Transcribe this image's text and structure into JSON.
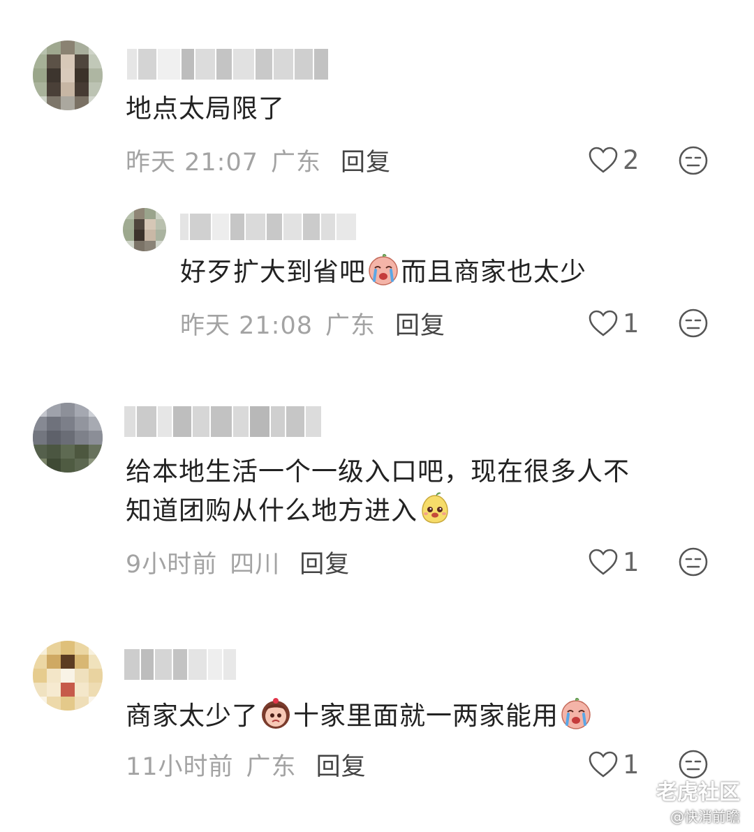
{
  "comments": [
    {
      "text": "地点太局限了",
      "time": "昨天 21:07",
      "location": "广东",
      "reply_label": "回复",
      "likes": "2"
    },
    {
      "text_before_emoji": "好歹扩大到省吧",
      "emoji": "crying-emoji",
      "text_after_emoji": "而且商家也太少",
      "time": "昨天 21:08",
      "location": "广东",
      "reply_label": "回复",
      "likes": "1"
    },
    {
      "text_line1": "给本地生活一个一级入口吧，现在很多人不",
      "text_line2": "知道团购从什么地方进入",
      "emoji": "smiling-pear-emoji",
      "time": "9小时前",
      "location": "四川",
      "reply_label": "回复",
      "likes": "1"
    },
    {
      "text_part1": "商家太少了",
      "emoji1": "sad-girl-emoji",
      "text_part2": "十家里面就一两家能用",
      "emoji2": "crying-emoji",
      "time": "11小时前",
      "location": "广东",
      "reply_label": "回复",
      "likes": "1"
    }
  ],
  "watermark": {
    "brand": "老虎社区",
    "author": "@快消前瞻"
  },
  "colors": {
    "meta_text": "#a3a3a3",
    "body_text": "#222222",
    "icon": "#555555"
  }
}
